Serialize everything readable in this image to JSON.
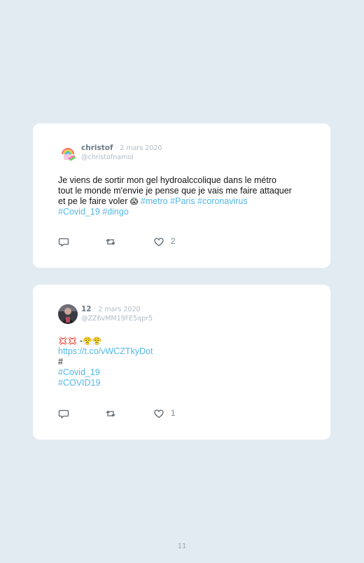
{
  "tweets": [
    {
      "author": {
        "name": "christof",
        "handle": "@christofnamoi",
        "avatar": "rainbow-emoji-avatar"
      },
      "date": "2 mars 2020",
      "separator": "·",
      "text": {
        "line1": "Je viens de sortir mon gel hydroalccolique dans le métro",
        "line2": "tout le monde m'envie je pense que je vais me faire attaquer",
        "line3_plain": "et pe le faire voler ",
        "line3_emoji": "😱",
        "line3_tags": " #metro #Paris #coronavirus",
        "line4_tags": "#Covid_19 #dingo"
      },
      "actions": {
        "reply_icon": "speech-bubble-icon",
        "retweet_icon": "retweet-icon",
        "like_icon": "heart-icon",
        "like_count": "2"
      }
    },
    {
      "author": {
        "name": "12",
        "handle": "@ZZ6vMM19FE5qpr5",
        "avatar": "photo-avatar"
      },
      "date": "2 mars 2020",
      "separator": "·",
      "text": {
        "line1_emoji": "💢💢",
        "line1_plain": " -",
        "line1_emoji2": "😤😤",
        "line2_link": "https://t.co/vWCZTkyDot",
        "line3": "#",
        "line4_tag": "#Covid_19",
        "line5_tag": "#COVID19"
      },
      "actions": {
        "reply_icon": "speech-bubble-icon",
        "retweet_icon": "retweet-icon",
        "like_icon": "heart-icon",
        "like_count": "1"
      }
    }
  ],
  "page": {
    "number": "11"
  },
  "colors": {
    "background": "#e3ebf2",
    "card": "#ffffff",
    "link": "#52b8e8",
    "muted": "#b0bbc4",
    "name": "#6b7b88"
  }
}
